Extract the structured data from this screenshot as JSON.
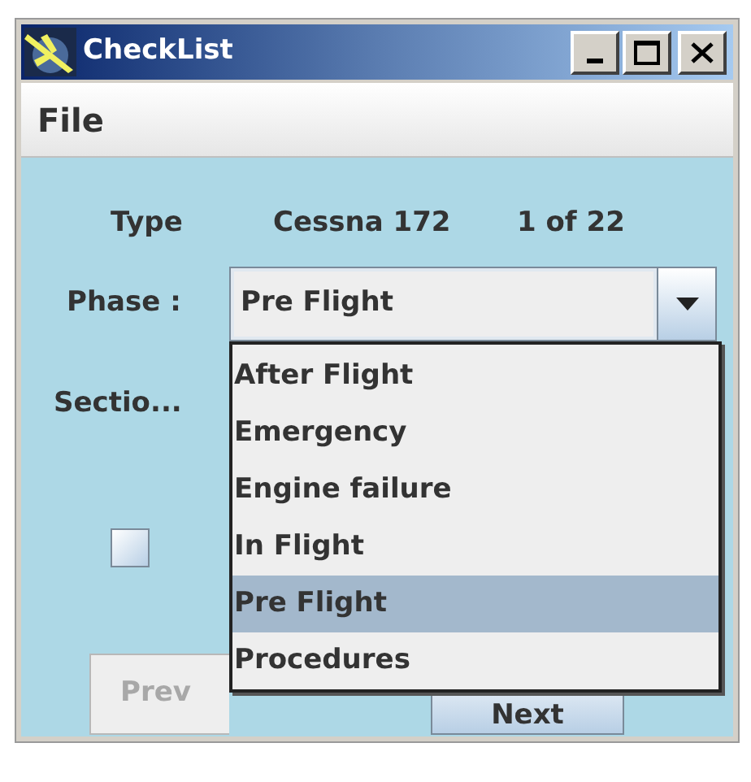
{
  "window": {
    "title": "CheckList"
  },
  "menu": [
    {
      "label": "File"
    }
  ],
  "info": {
    "type_label": "Type",
    "aircraft": "Cessna 172",
    "position": "1 of 22"
  },
  "phase": {
    "label": "Phase :",
    "value": "Pre Flight",
    "expanded": true,
    "options": [
      {
        "label": "After Flight",
        "selected": false
      },
      {
        "label": "Emergency",
        "selected": false
      },
      {
        "label": "Engine failure",
        "selected": false
      },
      {
        "label": "In Flight",
        "selected": false
      },
      {
        "label": "Pre Flight",
        "selected": true
      },
      {
        "label": "Procedures",
        "selected": false
      }
    ]
  },
  "section": {
    "label": "Sectio..."
  },
  "item": {
    "checked": false
  },
  "buttons": [
    {
      "label": "Prev",
      "disabled": true
    },
    {
      "label": "Next",
      "disabled": false
    }
  ]
}
